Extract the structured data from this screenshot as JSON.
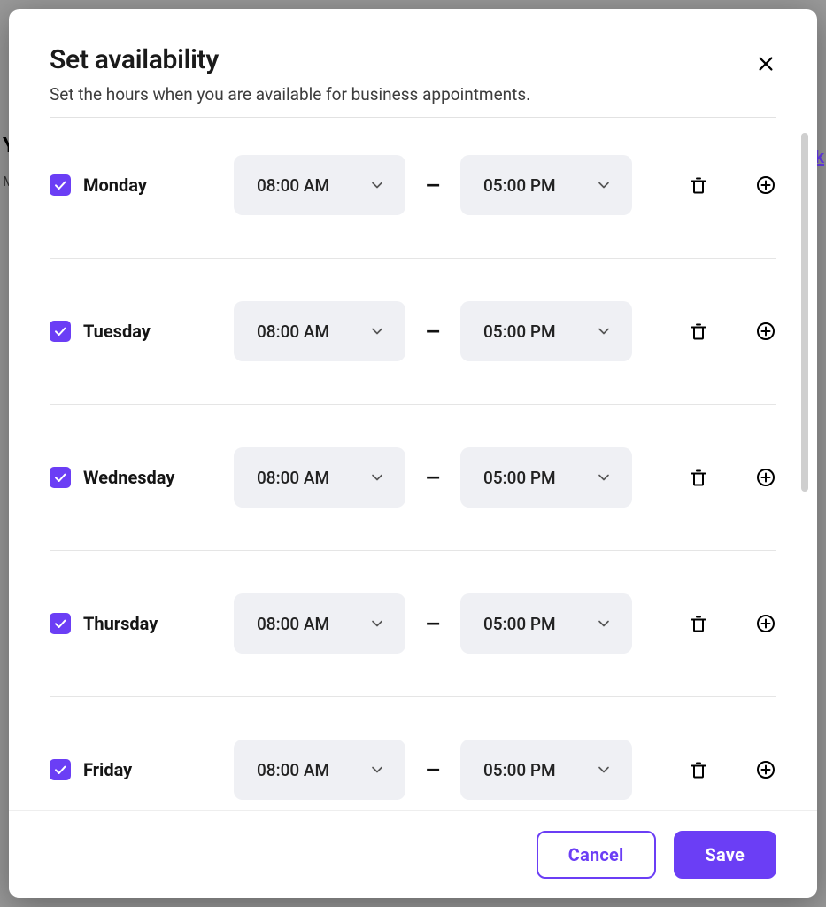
{
  "background_fragments": {
    "left1": "Y",
    "left2": "M",
    "right": "k"
  },
  "dialog": {
    "title": "Set availability",
    "subtitle": "Set the hours when you are available for business appointments.",
    "separator": "–"
  },
  "days": [
    {
      "name": "Monday",
      "checked": true,
      "start": "08:00 AM",
      "end": "05:00 PM"
    },
    {
      "name": "Tuesday",
      "checked": true,
      "start": "08:00 AM",
      "end": "05:00 PM"
    },
    {
      "name": "Wednesday",
      "checked": true,
      "start": "08:00 AM",
      "end": "05:00 PM"
    },
    {
      "name": "Thursday",
      "checked": true,
      "start": "08:00 AM",
      "end": "05:00 PM"
    },
    {
      "name": "Friday",
      "checked": true,
      "start": "08:00 AM",
      "end": "05:00 PM"
    }
  ],
  "footer": {
    "cancel_label": "Cancel",
    "save_label": "Save"
  },
  "icons": {
    "close": "close-icon",
    "chevron_down": "chevron-down-icon",
    "trash": "trash-icon",
    "add": "plus-circle-icon",
    "check": "check-icon"
  },
  "colors": {
    "accent": "#6b3ef5",
    "select_bg": "#eff0f4"
  }
}
